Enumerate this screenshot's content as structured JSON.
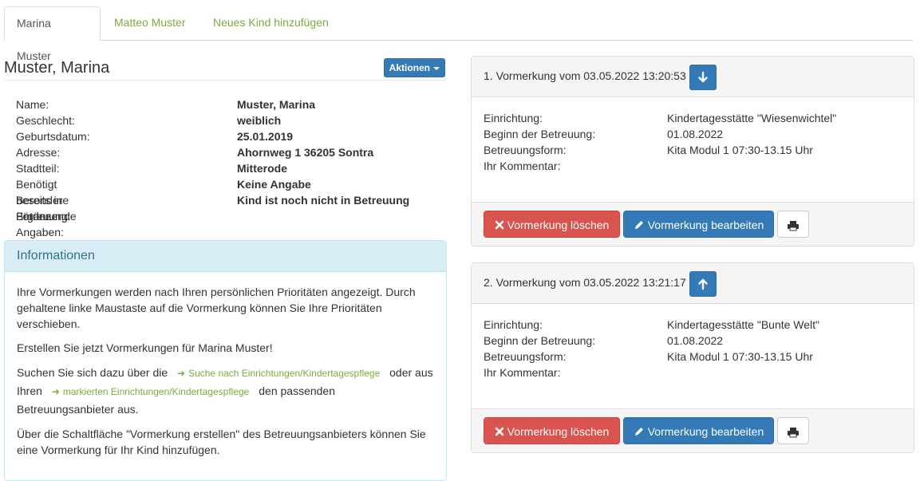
{
  "tabs": [
    {
      "label": "Marina Muster",
      "active": true
    },
    {
      "label": "Matteo Muster",
      "active": false
    },
    {
      "label": "Neues Kind hinzufügen",
      "active": false
    }
  ],
  "child": {
    "heading": "Muster, Marina",
    "actions_label": "Aktionen",
    "fields": [
      {
        "label": "Name:",
        "value": "Muster, Marina"
      },
      {
        "label": "Geschlecht:",
        "value": "weiblich"
      },
      {
        "label": "Geburtsdatum:",
        "value": "25.01.2019"
      },
      {
        "label": "Adresse:",
        "value": "Ahornweg 1 36205 Sontra"
      },
      {
        "label": "Stadtteil:",
        "value": "Mitterode"
      },
      {
        "label": "Benötigt besondere Förderung:",
        "value": "Keine Angabe"
      },
      {
        "label": "Bereits in Betreuung:",
        "value": "Kind ist noch nicht in Betreuung"
      },
      {
        "label": "Ergänzende Angaben:",
        "value": ""
      }
    ]
  },
  "info": {
    "title": "Informationen",
    "p1": "Ihre Vormerkungen werden nach Ihren persönlichen Prioritäten angezeigt. Durch gehaltene linke Maustaste auf die Vormerkung können Sie Ihre Prioritäten verschieben.",
    "p2": "Erstellen Sie jetzt Vormerkungen für Marina Muster!",
    "p3_a": "Suchen Sie sich dazu über die",
    "link1": "Suche nach Einrichtungen/Kindertagespflege",
    "p3_b": "oder aus Ihren",
    "link2": "markierten Einrichtungen/Kindertagespflege",
    "p3_c": "den passenden Betreuungsanbieter aus.",
    "p4": "Über die Schaltfläche \"Vormerkung erstellen\" des Betreuungsanbieters können Sie eine Vormerkung für Ihr Kind hinzufügen."
  },
  "reservations": [
    {
      "title": "1. Vormerkung vom 03.05.2022 13:20:53",
      "move_icon": "arrow-down-icon",
      "rows": [
        {
          "label": "Einrichtung:",
          "value": "Kindertagesstätte \"Wiesenwichtel\""
        },
        {
          "label": "Beginn der Betreuung:",
          "value": "01.08.2022"
        },
        {
          "label": "Betreuungsform:",
          "value": "Kita Modul 1 07:30-13.15 Uhr"
        },
        {
          "label": "Ihr Kommentar:",
          "value": ""
        }
      ],
      "delete_label": "Vormerkung löschen",
      "edit_label": "Vormerkung bearbeiten"
    },
    {
      "title": "2. Vormerkung vom 03.05.2022 13:21:17",
      "move_icon": "arrow-up-icon",
      "rows": [
        {
          "label": "Einrichtung:",
          "value": "Kindertagesstätte \"Bunte Welt\""
        },
        {
          "label": "Beginn der Betreuung:",
          "value": "01.08.2022"
        },
        {
          "label": "Betreuungsform:",
          "value": "Kita Modul 1 07:30-13.15 Uhr"
        },
        {
          "label": "Ihr Kommentar:",
          "value": ""
        }
      ],
      "delete_label": "Vormerkung löschen",
      "edit_label": "Vormerkung bearbeiten"
    }
  ],
  "colors": {
    "primary": "#337ab7",
    "danger": "#d9534f",
    "link": "#7aad3c",
    "info_bg": "#d9edf7"
  }
}
